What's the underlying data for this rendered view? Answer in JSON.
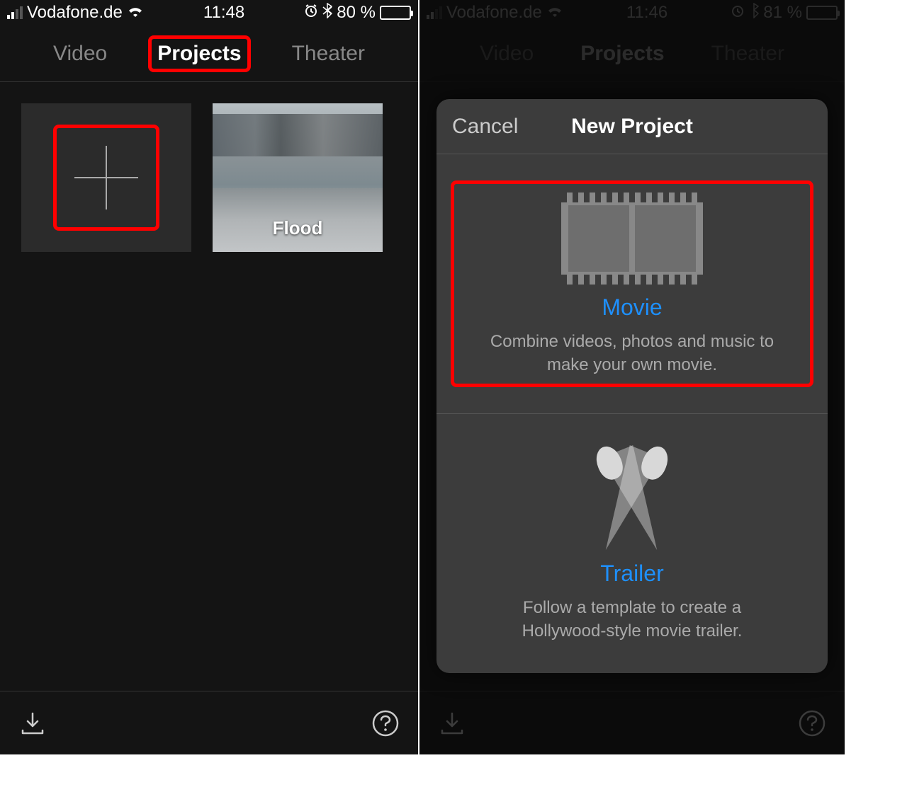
{
  "status": {
    "carrier": "Vodafone.de",
    "time": "11:48",
    "battery_pct": "80 %"
  },
  "status_right": {
    "carrier": "Vodafone.de",
    "time": "11:46",
    "battery_pct": "81 %"
  },
  "tabs": {
    "video": "Video",
    "projects": "Projects",
    "theater": "Theater"
  },
  "projects": {
    "item1_label": "Flood"
  },
  "sheet": {
    "cancel": "Cancel",
    "title": "New Project",
    "movie": {
      "title": "Movie",
      "desc": "Combine videos, photos and music to make your own movie."
    },
    "trailer": {
      "title": "Trailer",
      "desc": "Follow a template to create a Hollywood-style movie trailer."
    }
  }
}
